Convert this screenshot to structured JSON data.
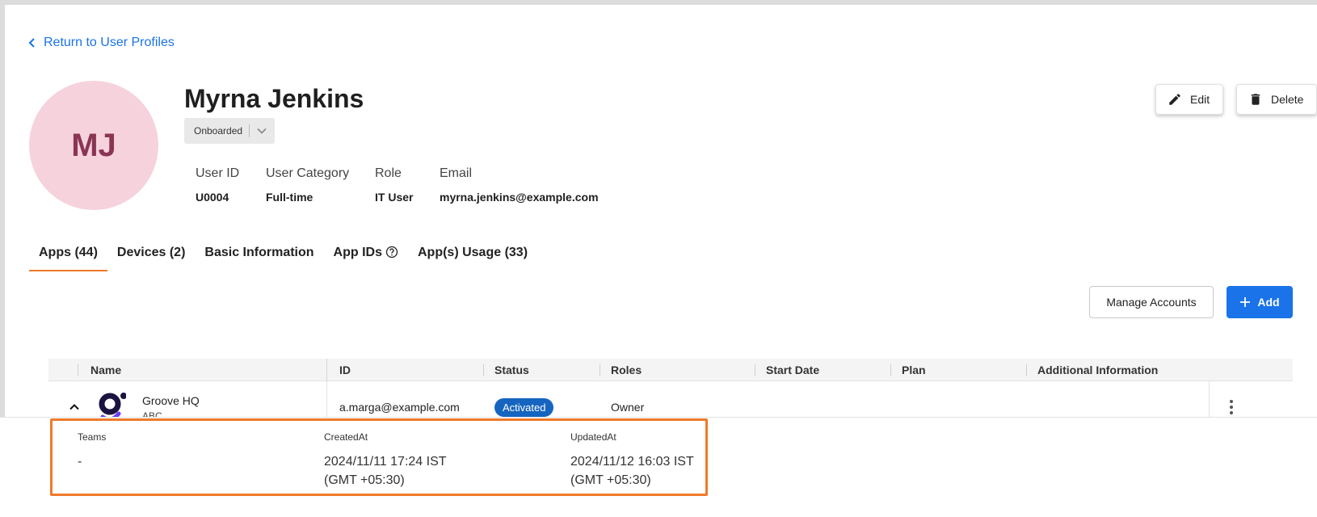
{
  "back_link": {
    "label": "Return to User Profiles"
  },
  "user": {
    "initials": "MJ",
    "name": "Myrna Jenkins",
    "status": "Onboarded",
    "fields": [
      {
        "key": "User ID",
        "value": "U0004"
      },
      {
        "key": "User Category",
        "value": "Full-time"
      },
      {
        "key": "Role",
        "value": "IT User"
      },
      {
        "key": "Email",
        "value": "myrna.jenkins@example.com"
      }
    ]
  },
  "actions": {
    "edit": "Edit",
    "delete": "Delete"
  },
  "tabs": [
    {
      "label": "Apps (44)",
      "active": true
    },
    {
      "label": "Devices (2)"
    },
    {
      "label": "Basic Information"
    },
    {
      "label": "App IDs"
    },
    {
      "label": "App(s) Usage (33)"
    }
  ],
  "toolbar": {
    "manage_label": "Manage Accounts",
    "add_label": "Add"
  },
  "table": {
    "columns": [
      "Name",
      "ID",
      "Status",
      "Roles",
      "Start Date",
      "Plan",
      "Additional Information"
    ],
    "rows": [
      {
        "name": "Groove HQ",
        "org": "ABC",
        "id": "a.marga@example.com",
        "status": "Activated",
        "roles": "Owner",
        "start_date": "",
        "plan": "",
        "additional": ""
      }
    ]
  },
  "detail": [
    {
      "key": "Teams",
      "value": "-"
    },
    {
      "key": "CreatedAt",
      "value": "2024/11/11 17:24 IST\n(GMT +05:30)"
    },
    {
      "key": "UpdatedAt",
      "value": "2024/11/12 16:03 IST\n(GMT +05:30)"
    }
  ],
  "colors": {
    "accent": "#1a73e8",
    "tab_indicator": "#ef7a2a",
    "avatar_bg": "#f6d2dd",
    "avatar_text": "#8a3554",
    "badge": "#1565c0"
  }
}
